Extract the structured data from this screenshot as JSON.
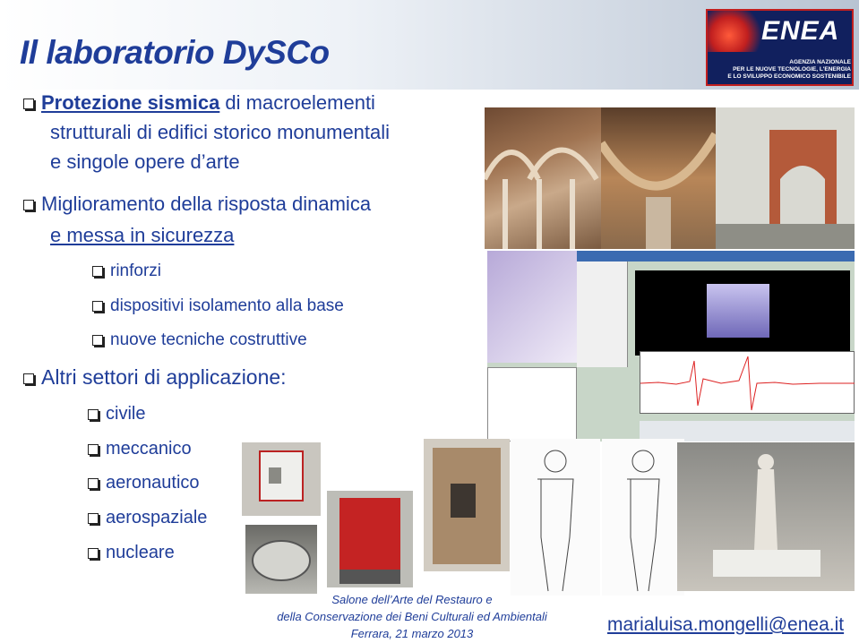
{
  "header": {
    "title": "Il laboratorio DySCo"
  },
  "logo": {
    "name": "ENEA",
    "lines": [
      "AGENZIA NAZIONALE",
      "PER LE NUOVE TECNOLOGIE, L'ENERGIA",
      "E LO SVILUPPO ECONOMICO SOSTENIBILE"
    ]
  },
  "bullets": {
    "b1": {
      "bold": "Protezione sismica",
      "rest": " di macroelementi",
      "line2": "strutturali di edifici storico monumentali",
      "line3": "e singole opere d’arte"
    },
    "b2": {
      "line1": "Miglioramento della risposta dinamica",
      "line2": "e messa in sicurezza"
    },
    "sub": [
      "rinforzi",
      "dispositivi isolamento alla base",
      "nuove tecniche costruttive"
    ],
    "b3": "Altri settori di applicazione:",
    "sectors": [
      "civile",
      "meccanico",
      "aeronautico",
      "aerospaziale",
      "nucleare"
    ]
  },
  "footer": {
    "line1": "Salone dell’Arte del Restauro e",
    "line2": "della Conservazione dei Beni Culturali ed Ambientali",
    "line3": "Ferrara, 21 marzo 2013"
  },
  "email": "marialuisa.mongelli@enea.it"
}
